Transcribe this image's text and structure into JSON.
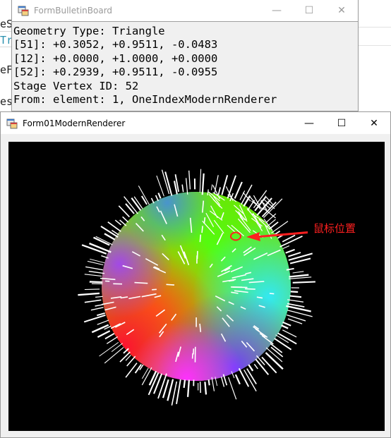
{
  "background": {
    "fragments": [
      "eS",
      "Tr",
      "eF",
      "es"
    ]
  },
  "bulletin_window": {
    "title": "FormBulletinBoard",
    "minimize_glyph": "—",
    "maximize_glyph": "☐",
    "close_glyph": "✕",
    "lines": [
      "Geometry Type: Triangle",
      "[51]: +0.3052, +0.9511, -0.0483",
      "[12]: +0.0000, +1.0000, +0.0000",
      "[52]: +0.2939, +0.9511, -0.0955",
      "Stage Vertex ID: 52",
      "From: element: 1, OneIndexModernRenderer"
    ]
  },
  "renderer_window": {
    "title": "Form01ModernRenderer",
    "minimize_glyph": "—",
    "maximize_glyph": "☐",
    "close_glyph": "✕",
    "annotation_label": "鼠标位置",
    "annotation_color": "#ff2020",
    "canvas_background": "#000000",
    "sphere_gradient_colors": [
      "#ff1020",
      "#ff8c00",
      "#7fe000",
      "#2aff40",
      "#40d8ff",
      "#8a4dff",
      "#ff40ff"
    ],
    "normal_line_color": "#ffffff"
  },
  "icons": {
    "app_icon": "windows-form-icon",
    "marker": "mouse-position-circle-icon",
    "arrow": "red-arrow-icon"
  }
}
